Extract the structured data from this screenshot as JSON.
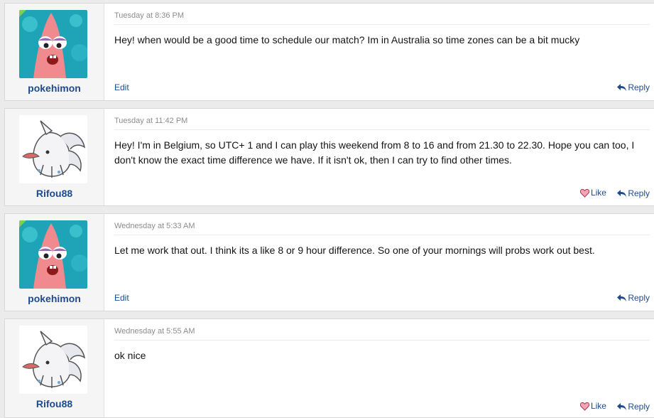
{
  "thread": {
    "posts": [
      {
        "author": "pokehimon",
        "avatar": "patrick-star-avatar",
        "date": "Tuesday at 8:36 PM",
        "body": "Hey! when would be a good time to schedule our match? Im in Australia so time zones can be a bit mucky",
        "edit_label": "Edit",
        "reply_label": "Reply"
      },
      {
        "author": "Rifou88",
        "avatar": "white-creature-avatar",
        "date": "Tuesday at 11:42 PM",
        "body": "Hey! I'm in Belgium, so UTC+ 1 and I can play this weekend from 8 to 16 and from 21.30 to 22.30. Hope you can too, I don't know the exact time difference we have. If it isn't ok, then I can try to find other times.",
        "like_label": "Like",
        "reply_label": "Reply"
      },
      {
        "author": "pokehimon",
        "avatar": "patrick-star-avatar",
        "date": "Wednesday at 5:33 AM",
        "body": "Let me work that out. I think its a like 8 or 9 hour difference. So one of your mornings will probs work out best.",
        "edit_label": "Edit",
        "reply_label": "Reply"
      },
      {
        "author": "Rifou88",
        "avatar": "white-creature-avatar",
        "date": "Wednesday at 5:55 AM",
        "body": "ok nice",
        "like_label": "Like",
        "reply_label": "Reply"
      }
    ]
  },
  "icons": {
    "reply": "reply-arrow-icon",
    "like": "like-heart-icon"
  },
  "colors": {
    "link": "#1e4a8f",
    "page_bg": "#ebebeb",
    "user_cell_bg": "#f5f5f5",
    "date_text": "#8c8c8c"
  }
}
